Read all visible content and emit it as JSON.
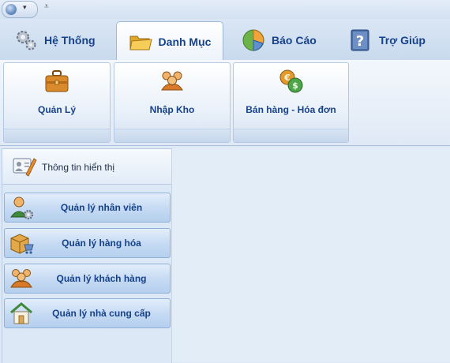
{
  "tabs": [
    {
      "label": "Hệ Thống",
      "icon": "gears-icon",
      "active": false
    },
    {
      "label": "Danh Mục",
      "icon": "folder-icon",
      "active": true
    },
    {
      "label": "Báo Cáo",
      "icon": "pie-chart-icon",
      "active": false
    },
    {
      "label": "Trợ Giúp",
      "icon": "help-book-icon",
      "active": false
    }
  ],
  "ribbon": {
    "buttons": [
      {
        "label": "Quản Lý",
        "icon": "briefcase-icon"
      },
      {
        "label": "Nhập Kho",
        "icon": "people-group-icon"
      },
      {
        "label": "Bán hàng - Hóa đơn",
        "icon": "coins-icon"
      }
    ]
  },
  "panel": {
    "title": "Thông tin hiển thị",
    "icon": "user-card-pen-icon",
    "items": [
      {
        "label": "Quản lý nhân viên",
        "icon": "user-gear-icon"
      },
      {
        "label": "Quản lý hàng hóa",
        "icon": "box-cart-icon"
      },
      {
        "label": "Quản lý khách hàng",
        "icon": "customers-icon"
      },
      {
        "label": "Quản lý nhà cung cấp",
        "icon": "house-icon"
      }
    ]
  }
}
